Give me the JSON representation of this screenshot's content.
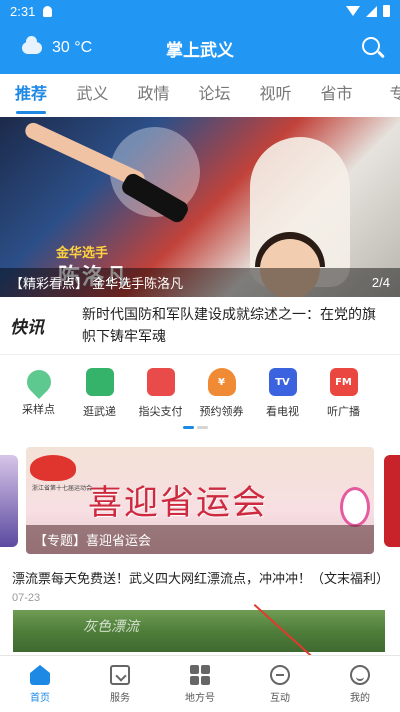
{
  "status_bar": {
    "time": "2:31"
  },
  "header": {
    "weather_temp": "30 °C",
    "title": "掌上武义"
  },
  "tabs": [
    {
      "label": "推荐",
      "active": true
    },
    {
      "label": "武义"
    },
    {
      "label": "政情"
    },
    {
      "label": "论坛"
    },
    {
      "label": "视听"
    },
    {
      "label": "省市"
    },
    {
      "label": "专"
    }
  ],
  "hero": {
    "caption_tag": "金华选手",
    "caption_name": "陈洛凡",
    "title": "【精彩看点】 金华选手陈洛凡",
    "counter": "2/4"
  },
  "flash_news": {
    "logo": "快讯",
    "text": "新时代国防和军队建设成就综述之一：在党的旗帜下铸牢军魂"
  },
  "quick_links": [
    {
      "label": "采样点",
      "icon": "location-icon"
    },
    {
      "label": "逛武递",
      "icon": "document-icon"
    },
    {
      "label": "指尖支付",
      "icon": "payment-icon"
    },
    {
      "label": "预约领券",
      "icon": "coupon-icon"
    },
    {
      "label": "看电视",
      "icon": "tv-icon"
    },
    {
      "label": "听广播",
      "icon": "radio-icon"
    }
  ],
  "topic": {
    "logo_text": "浙江省第十七届运动会",
    "headline": "喜迎省运会",
    "caption": "【专题】喜迎省运会"
  },
  "article": {
    "title": "漂流票每天免费送！武义四大网红漂流点，冲冲冲！（文末福利）",
    "date": "07-23",
    "image_text": "灰色漂流"
  },
  "bottom_nav": [
    {
      "label": "首页",
      "icon": "home-icon",
      "active": true
    },
    {
      "label": "服务",
      "icon": "service-icon"
    },
    {
      "label": "地方号",
      "icon": "local-icon"
    },
    {
      "label": "互动",
      "icon": "interact-icon"
    },
    {
      "label": "我的",
      "icon": "profile-icon"
    }
  ],
  "colors": {
    "primary": "#2196f3",
    "active": "#1e88e5",
    "annotation": "#e23a2d"
  }
}
